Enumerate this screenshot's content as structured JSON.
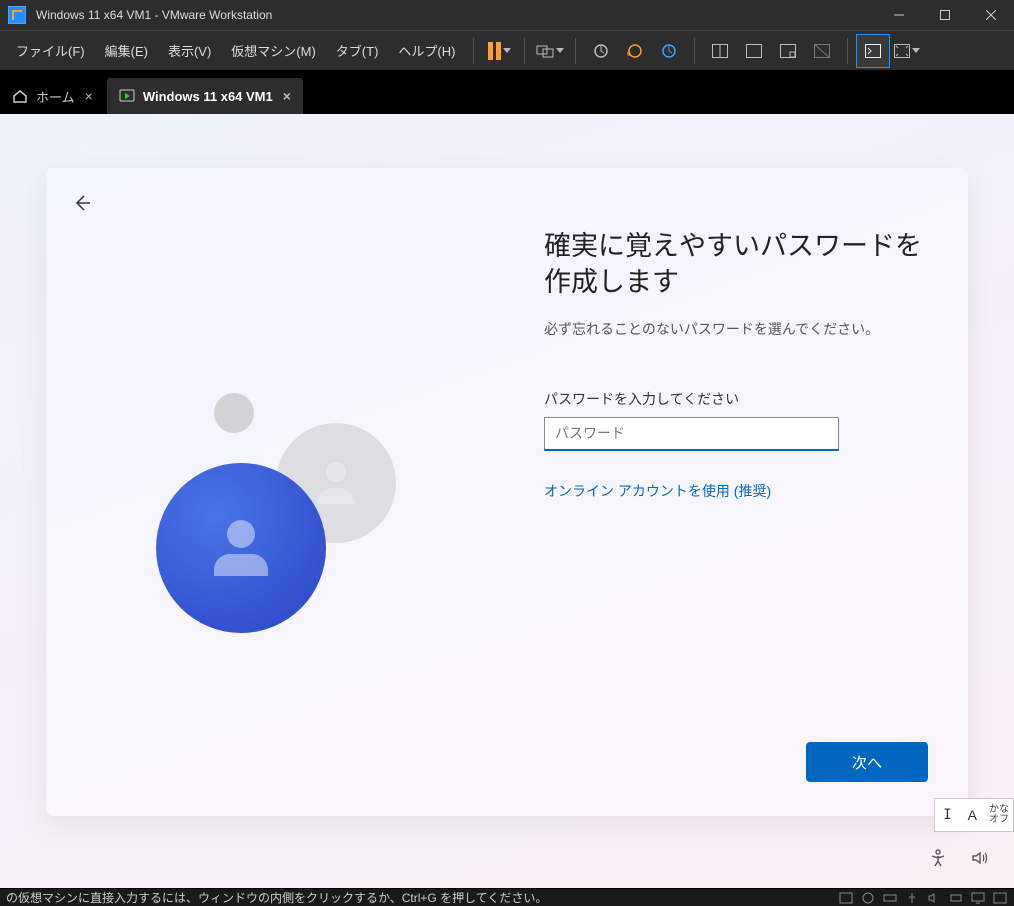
{
  "titlebar": {
    "title": "Windows 11 x64 VM1 - VMware Workstation"
  },
  "menubar": {
    "file": "ファイル(F)",
    "edit": "編集(E)",
    "view": "表示(V)",
    "vm": "仮想マシン(M)",
    "tabs": "タブ(T)",
    "help": "ヘルプ(H)"
  },
  "tabs": {
    "home": "ホーム",
    "active": "Windows 11 x64 VM1"
  },
  "oobe": {
    "heading": "確実に覚えやすいパスワードを作成します",
    "subtitle": "必ず忘れることのないパスワードを選んでください。",
    "field_label": "パスワードを入力してください",
    "placeholder": "パスワード",
    "online_link": "オンライン アカウントを使用 (推奨)",
    "next": "次へ"
  },
  "ime": {
    "cursor": "I",
    "mode": "A",
    "sub1": "かな",
    "sub2": "オフ"
  },
  "statusbar": {
    "hint": "の仮想マシンに直接入力するには、ウィンドウの内側をクリックするか、Ctrl+G を押してください。"
  },
  "icons": {
    "minimize": "minimize-icon",
    "maximize": "maximize-icon",
    "close": "close-icon"
  }
}
